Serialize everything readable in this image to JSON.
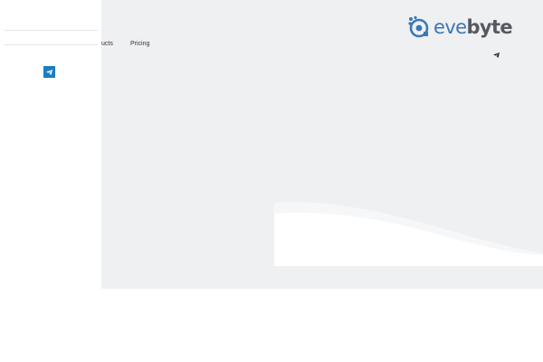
{
  "brand": {
    "name_part1": "eve",
    "name_part2": "byte",
    "colors": {
      "accent": "#3a78b4",
      "text": "#555a60"
    }
  },
  "nav": {
    "items": [
      {
        "label": "Products",
        "visible_text": "ucts"
      },
      {
        "label": "Pricing"
      }
    ]
  },
  "icons": {
    "header_contact": "paper-plane-icon",
    "drawer_contact": "telegram-icon",
    "logo": "evebyte-logo-icon"
  },
  "colors": {
    "hero_background": "#eff0f2",
    "page_background": "#ffffff",
    "drawer_background": "#ffffff",
    "telegram_button": "#1a7ec2"
  }
}
